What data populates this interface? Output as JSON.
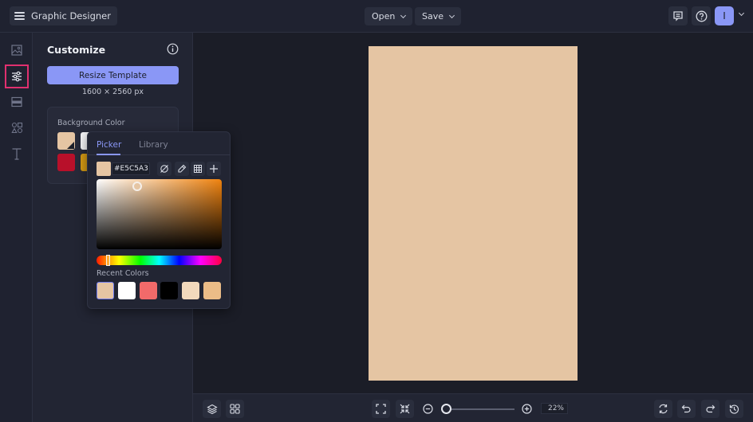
{
  "topbar": {
    "app_title": "Graphic Designer",
    "open_label": "Open",
    "save_label": "Save",
    "avatar_initial": "I"
  },
  "rail": {
    "items": [
      {
        "name": "images",
        "icon": "image-icon"
      },
      {
        "name": "customize",
        "icon": "sliders-icon",
        "active": true
      },
      {
        "name": "layouts",
        "icon": "layout-icon"
      },
      {
        "name": "elements",
        "icon": "shapes-icon"
      },
      {
        "name": "text",
        "icon": "text-icon"
      }
    ]
  },
  "panel": {
    "title": "Customize",
    "resize_label": "Resize Template",
    "dimensions": "1600 × 2560 px",
    "background_label": "Background Color",
    "swatches": [
      "#e5c5a3",
      "#f4f4f6",
      "#b8102a",
      "#d49a14"
    ]
  },
  "color_picker": {
    "tabs": [
      {
        "label": "Picker",
        "active": true
      },
      {
        "label": "Library",
        "active": false
      }
    ],
    "hex_value": "#E5C5A3",
    "current_color": "#e5c5a3",
    "recent_label": "Recent Colors",
    "recent_colors": [
      "#e5c5a3",
      "#ffffff",
      "#f26a6a",
      "#000000",
      "#f2d9bc",
      "#ebbc87"
    ],
    "hue_color": "#f0830f"
  },
  "canvas": {
    "background": "#e5c5a3"
  },
  "bottombar": {
    "zoom_value": "22%",
    "zoom_fraction": 0.0
  }
}
